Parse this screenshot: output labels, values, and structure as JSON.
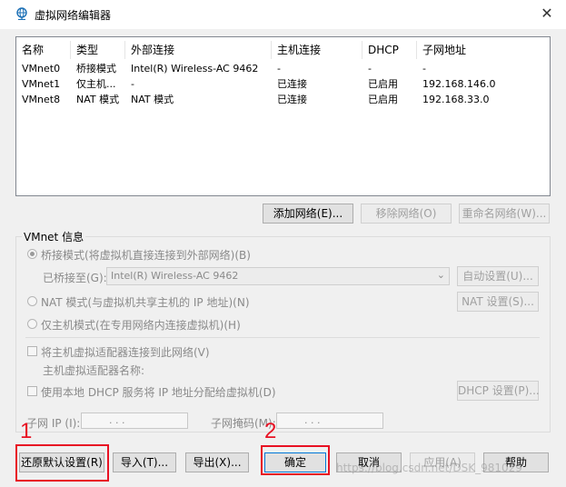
{
  "window": {
    "title": "虚拟网络编辑器",
    "close": "✕"
  },
  "table": {
    "headers": [
      "名称",
      "类型",
      "外部连接",
      "主机连接",
      "DHCP",
      "子网地址"
    ],
    "rows": [
      [
        "VMnet0",
        "桥接模式",
        "Intel(R) Wireless-AC 9462",
        "-",
        "-",
        "-"
      ],
      [
        "VMnet1",
        "仅主机...",
        "-",
        "已连接",
        "已启用",
        "192.168.146.0"
      ],
      [
        "VMnet8",
        "NAT 模式",
        "NAT 模式",
        "已连接",
        "已启用",
        "192.168.33.0"
      ]
    ]
  },
  "net_buttons": {
    "add": "添加网络(E)...",
    "remove": "移除网络(O)",
    "rename": "重命名网络(W)..."
  },
  "vmnet_info": {
    "label": "VMnet 信息",
    "bridge_radio": "桥接模式(将虚拟机直接连接到外部网络)(B)",
    "bridged_to_label": "已桥接至(G):",
    "bridged_to_value": "Intel(R) Wireless-AC 9462",
    "auto_settings": "自动设置(U)...",
    "nat_radio": "NAT 模式(与虚拟机共享主机的 IP 地址)(N)",
    "nat_settings": "NAT 设置(S)...",
    "host_only_radio": "仅主机模式(在专用网络内连接虚拟机)(H)",
    "connect_adapter_check": "将主机虚拟适配器连接到此网络(V)",
    "adapter_name_label": "主机虚拟适配器名称:",
    "dhcp_check": "使用本地 DHCP 服务将 IP 地址分配给虚拟机(D)",
    "dhcp_settings": "DHCP 设置(P)...",
    "subnet_ip_label": "子网 IP (I):",
    "subnet_mask_label": "子网掩码(M):",
    "ip_dots": ".       .       ."
  },
  "footer": {
    "restore": "还原默认设置(R)",
    "import": "导入(T)...",
    "export": "导出(X)...",
    "ok": "确定",
    "cancel": "取消",
    "apply": "应用(A)",
    "help": "帮助"
  },
  "annotations": {
    "label1": "1",
    "label2": "2"
  },
  "watermark": "https://blog.csdn.net/DSK_981029",
  "colors": {
    "highlight": "#e81123",
    "accent": "#0078d7"
  }
}
